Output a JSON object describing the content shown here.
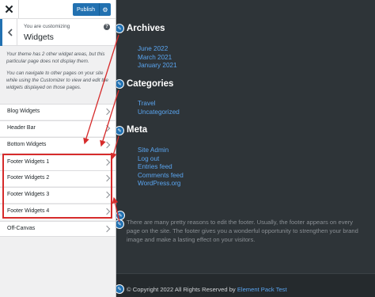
{
  "customizer": {
    "publish_label": "Publish",
    "customizing_label": "You are customizing",
    "section_title": "Widgets",
    "description": [
      "Your theme has 2 other widget areas, but this particular page does not display them.",
      "You can navigate to other pages on your site while using the Customizer to view and edit the widgets displayed on those pages."
    ],
    "widget_areas": [
      "Blog Widgets",
      "Header Bar",
      "Bottom Widgets",
      "Footer Widgets 1",
      "Footer Widgets 2",
      "Footer Widgets 3",
      "Footer Widgets 4",
      "Off-Canvas"
    ]
  },
  "preview": {
    "archives": {
      "title": "Archives",
      "links": [
        "June 2022",
        "March 2021",
        "January 2021"
      ]
    },
    "categories": {
      "title": "Categories",
      "links": [
        "Travel",
        "Uncategorized"
      ]
    },
    "meta": {
      "title": "Meta",
      "links": [
        "Site Admin",
        "Log out",
        "Entries feed",
        "Comments feed",
        "WordPress.org"
      ]
    },
    "footer_text": "There are many pretty reasons to edit the footer. Usually, the footer appears on every page on the site. The footer gives you a wonderful opportunity to strengthen your brand image and make a lasting effect on your visitors.",
    "copyright_prefix": "© Copyright 2022 All Rights Reserved by ",
    "copyright_link": "Element Pack Test"
  },
  "colors": {
    "accent": "#2271b1",
    "preview_bg": "#2e3438",
    "link": "#5aa5f0",
    "annotation": "#d62b2b"
  }
}
